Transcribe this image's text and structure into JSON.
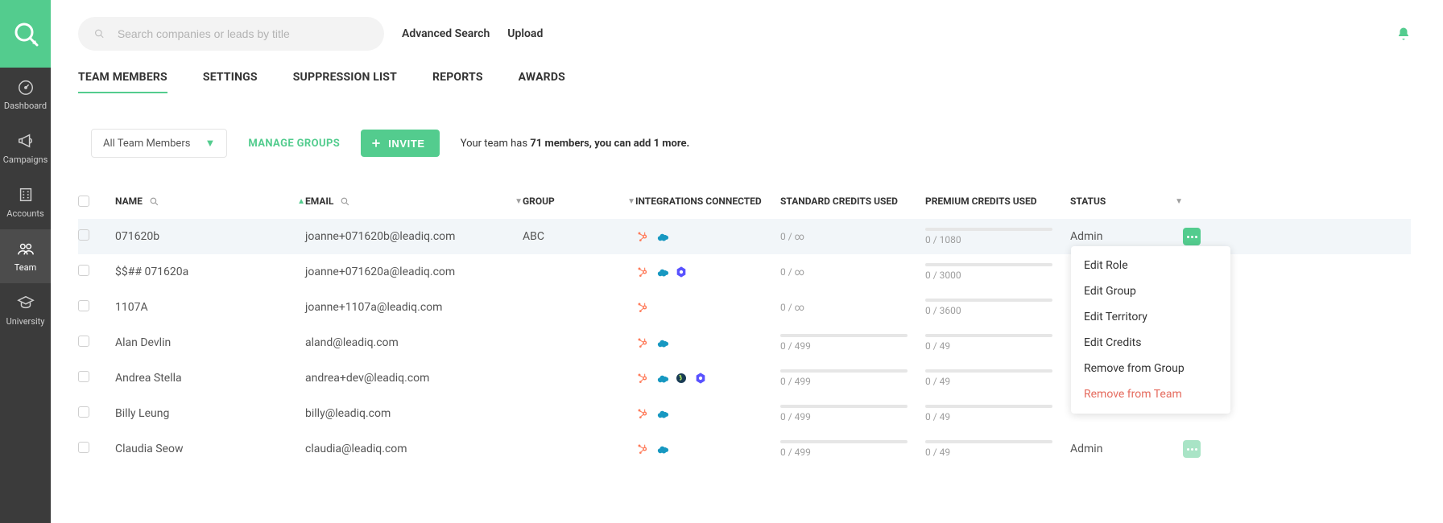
{
  "sidebar": {
    "items": [
      {
        "label": "Dashboard"
      },
      {
        "label": "Campaigns"
      },
      {
        "label": "Accounts"
      },
      {
        "label": "Team"
      },
      {
        "label": "University"
      }
    ]
  },
  "topbar": {
    "search_placeholder": "Search companies or leads by title",
    "advanced_search": "Advanced Search",
    "upload": "Upload"
  },
  "tabs": [
    {
      "label": "TEAM MEMBERS",
      "active": true
    },
    {
      "label": "SETTINGS"
    },
    {
      "label": "SUPPRESSION LIST"
    },
    {
      "label": "REPORTS"
    },
    {
      "label": "AWARDS"
    }
  ],
  "toolbar": {
    "group_filter": "All Team Members",
    "manage_groups": "MANAGE GROUPS",
    "invite": "INVITE",
    "team_info_prefix": "Your team has ",
    "team_info_count": "71 members, you can add 1 more."
  },
  "columns": {
    "name": "NAME",
    "email": "EMAIL",
    "group": "GROUP",
    "integrations": "INTEGRATIONS CONNECTED",
    "standard": "STANDARD CREDITS USED",
    "premium": "PREMIUM CREDITS USED",
    "status": "STATUS"
  },
  "rows": [
    {
      "name": "071620b",
      "email": "joanne+071620b@leadiq.com",
      "group": "ABC",
      "integrations": [
        "hubspot",
        "salesforce"
      ],
      "standard": "0 / ∞",
      "premium": "0 / 1080",
      "status": "Admin",
      "selected": true
    },
    {
      "name": "$$## 071620a",
      "email": "joanne+071620a@leadiq.com",
      "group": "",
      "integrations": [
        "hubspot",
        "salesforce",
        "outreach"
      ],
      "standard": "0 / ∞",
      "premium": "0 / 3000",
      "status": ""
    },
    {
      "name": "1107A",
      "email": "joanne+1107a@leadiq.com",
      "group": "",
      "integrations": [
        "hubspot"
      ],
      "standard": "0 / ∞",
      "premium": "0 / 3600",
      "status": ""
    },
    {
      "name": "Alan Devlin",
      "email": "aland@leadiq.com",
      "group": "",
      "integrations": [
        "hubspot",
        "salesforce"
      ],
      "standard": "0 / 499",
      "premium": "0 / 49",
      "status": ""
    },
    {
      "name": "Andrea Stella",
      "email": "andrea+dev@leadiq.com",
      "group": "",
      "integrations": [
        "hubspot",
        "salesforce",
        "salesloft",
        "outreach"
      ],
      "standard": "0 / 499",
      "premium": "0 / 49",
      "status": ""
    },
    {
      "name": "Billy Leung",
      "email": "billy@leadiq.com",
      "group": "",
      "integrations": [
        "hubspot",
        "salesforce"
      ],
      "standard": "0 / 499",
      "premium": "0 / 49",
      "status": ""
    },
    {
      "name": "Claudia Seow",
      "email": "claudia@leadiq.com",
      "group": "",
      "integrations": [
        "hubspot",
        "salesforce"
      ],
      "standard": "0 / 499",
      "premium": "0 / 49",
      "status": "Admin"
    }
  ],
  "menu": {
    "edit_role": "Edit Role",
    "edit_group": "Edit Group",
    "edit_territory": "Edit Territory",
    "edit_credits": "Edit Credits",
    "remove_from_group": "Remove from Group",
    "remove_from_team": "Remove from Team"
  }
}
